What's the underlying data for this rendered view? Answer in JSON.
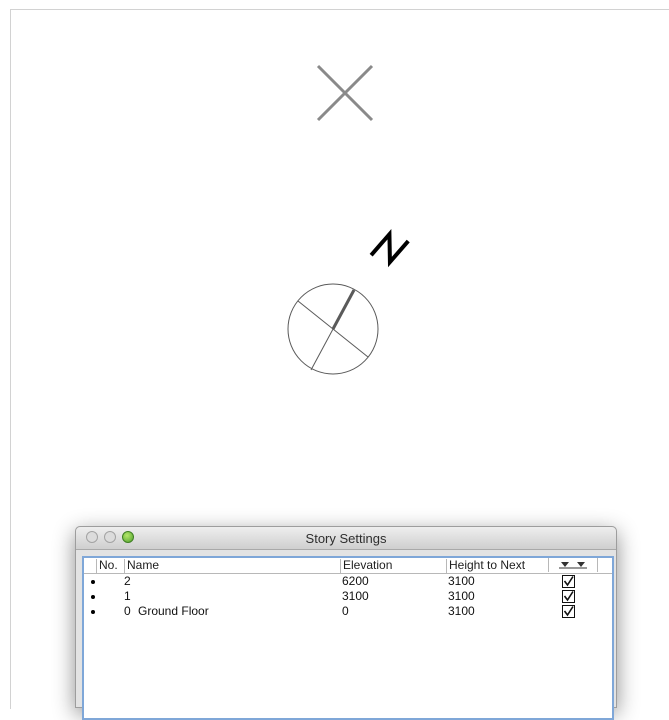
{
  "dialog": {
    "title": "Story Settings",
    "columns": {
      "no": "No.",
      "name": "Name",
      "elevation": "Elevation",
      "height_to_next": "Height to Next",
      "show_icon": "show-hide-stories-icon"
    },
    "rows": [
      {
        "no": "2",
        "name": "",
        "elevation": "6200",
        "height_to_next": "3100",
        "visible": true
      },
      {
        "no": "1",
        "name": "",
        "elevation": "3100",
        "height_to_next": "3100",
        "visible": true
      },
      {
        "no": "0",
        "name": "Ground Floor",
        "elevation": "0",
        "height_to_next": "3100",
        "visible": true
      }
    ],
    "accent_color": "#7fa7d8"
  },
  "canvas": {
    "north_label": "N",
    "icons": [
      "delete-x-icon",
      "north-arrow-icon",
      "compass-icon"
    ]
  }
}
